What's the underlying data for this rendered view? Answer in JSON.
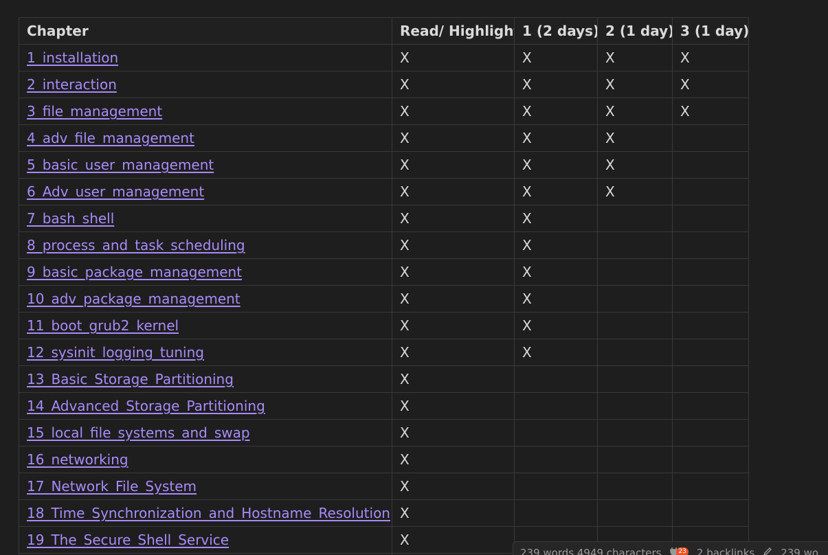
{
  "table": {
    "headers": [
      "Chapter",
      "Read/ Highlight",
      "1 (2 days)",
      "2 (1 day)",
      "3 (1 day)"
    ],
    "rows": [
      {
        "chapter": "1_installation",
        "cells": [
          "X",
          "X",
          "X",
          "X"
        ]
      },
      {
        "chapter": "2_interaction",
        "cells": [
          "X",
          "X",
          "X",
          "X"
        ]
      },
      {
        "chapter": "3_file_management",
        "cells": [
          "X",
          "X",
          "X",
          "X"
        ]
      },
      {
        "chapter": "4_adv_file_management",
        "cells": [
          "X",
          "X",
          "X",
          ""
        ]
      },
      {
        "chapter": "5_basic_user_management",
        "cells": [
          "X",
          "X",
          "X",
          ""
        ]
      },
      {
        "chapter": "6_Adv_user_management",
        "cells": [
          "X",
          "X",
          "X",
          ""
        ]
      },
      {
        "chapter": "7_bash_shell",
        "cells": [
          "X",
          "X",
          "",
          ""
        ]
      },
      {
        "chapter": "8_process_and_task_scheduling",
        "cells": [
          "X",
          "X",
          "",
          ""
        ]
      },
      {
        "chapter": "9_basic_package_management",
        "cells": [
          "X",
          "X",
          "",
          ""
        ]
      },
      {
        "chapter": "10_adv_package_management",
        "cells": [
          "X",
          "X",
          "",
          ""
        ]
      },
      {
        "chapter": "11_boot_grub2_kernel",
        "cells": [
          "X",
          "X",
          "",
          ""
        ]
      },
      {
        "chapter": "12_sysinit_logging_tuning",
        "cells": [
          "X",
          "X",
          "",
          ""
        ]
      },
      {
        "chapter": "13_Basic_Storage_Partitioning",
        "cells": [
          "X",
          "",
          "",
          ""
        ]
      },
      {
        "chapter": "14_Advanced_Storage_Partitioning",
        "cells": [
          "X",
          "",
          "",
          ""
        ]
      },
      {
        "chapter": "15_local_file_systems_and_swap",
        "cells": [
          "X",
          "",
          "",
          ""
        ]
      },
      {
        "chapter": "16_networking",
        "cells": [
          "X",
          "",
          "",
          ""
        ]
      },
      {
        "chapter": "17_Network_File_System",
        "cells": [
          "X",
          "",
          "",
          ""
        ]
      },
      {
        "chapter": "18_Time_Synchronization_and_Hostname_Resolution",
        "cells": [
          "X",
          "",
          "",
          ""
        ]
      },
      {
        "chapter": "19_The_Secure_Shell_Service",
        "cells": [
          "X",
          "",
          "",
          ""
        ]
      },
      {
        "chapter": "",
        "cells": [
          "",
          "",
          "",
          ""
        ]
      }
    ]
  },
  "status_bar": {
    "counts": "239 words 4949 characters",
    "plugin_badge": "23",
    "backlinks": "2 backlinks",
    "edit_counts": "239 wo"
  },
  "colors": {
    "background": "#1e1e1e",
    "link": "#a88bfa",
    "text": "#dadada",
    "border": "#3a3a3a",
    "badge": "#e8552a"
  },
  "icons": {
    "plugin": "plug-icon",
    "edit": "pencil-icon"
  }
}
